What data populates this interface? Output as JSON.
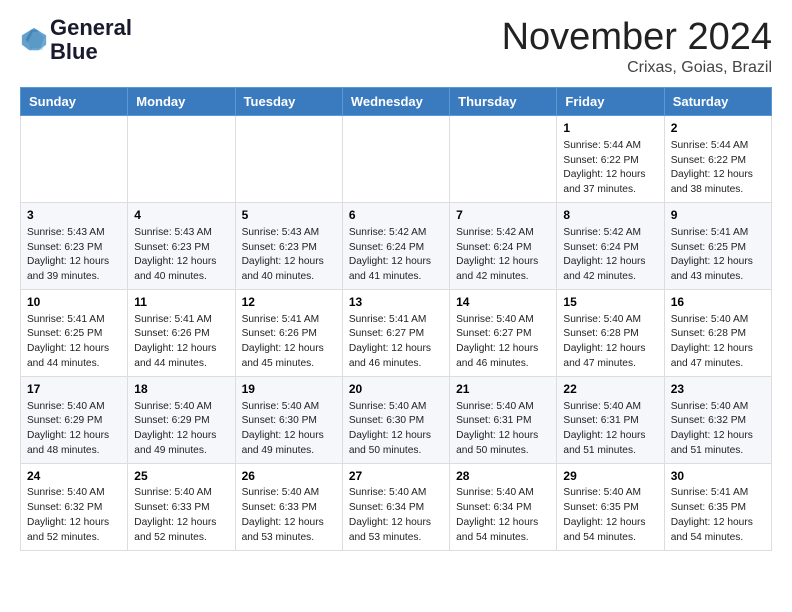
{
  "logo": {
    "line1": "General",
    "line2": "Blue"
  },
  "title": "November 2024",
  "location": "Crixas, Goias, Brazil",
  "headers": [
    "Sunday",
    "Monday",
    "Tuesday",
    "Wednesday",
    "Thursday",
    "Friday",
    "Saturday"
  ],
  "weeks": [
    [
      {
        "day": "",
        "info": ""
      },
      {
        "day": "",
        "info": ""
      },
      {
        "day": "",
        "info": ""
      },
      {
        "day": "",
        "info": ""
      },
      {
        "day": "",
        "info": ""
      },
      {
        "day": "1",
        "info": "Sunrise: 5:44 AM\nSunset: 6:22 PM\nDaylight: 12 hours\nand 37 minutes."
      },
      {
        "day": "2",
        "info": "Sunrise: 5:44 AM\nSunset: 6:22 PM\nDaylight: 12 hours\nand 38 minutes."
      }
    ],
    [
      {
        "day": "3",
        "info": "Sunrise: 5:43 AM\nSunset: 6:23 PM\nDaylight: 12 hours\nand 39 minutes."
      },
      {
        "day": "4",
        "info": "Sunrise: 5:43 AM\nSunset: 6:23 PM\nDaylight: 12 hours\nand 40 minutes."
      },
      {
        "day": "5",
        "info": "Sunrise: 5:43 AM\nSunset: 6:23 PM\nDaylight: 12 hours\nand 40 minutes."
      },
      {
        "day": "6",
        "info": "Sunrise: 5:42 AM\nSunset: 6:24 PM\nDaylight: 12 hours\nand 41 minutes."
      },
      {
        "day": "7",
        "info": "Sunrise: 5:42 AM\nSunset: 6:24 PM\nDaylight: 12 hours\nand 42 minutes."
      },
      {
        "day": "8",
        "info": "Sunrise: 5:42 AM\nSunset: 6:24 PM\nDaylight: 12 hours\nand 42 minutes."
      },
      {
        "day": "9",
        "info": "Sunrise: 5:41 AM\nSunset: 6:25 PM\nDaylight: 12 hours\nand 43 minutes."
      }
    ],
    [
      {
        "day": "10",
        "info": "Sunrise: 5:41 AM\nSunset: 6:25 PM\nDaylight: 12 hours\nand 44 minutes."
      },
      {
        "day": "11",
        "info": "Sunrise: 5:41 AM\nSunset: 6:26 PM\nDaylight: 12 hours\nand 44 minutes."
      },
      {
        "day": "12",
        "info": "Sunrise: 5:41 AM\nSunset: 6:26 PM\nDaylight: 12 hours\nand 45 minutes."
      },
      {
        "day": "13",
        "info": "Sunrise: 5:41 AM\nSunset: 6:27 PM\nDaylight: 12 hours\nand 46 minutes."
      },
      {
        "day": "14",
        "info": "Sunrise: 5:40 AM\nSunset: 6:27 PM\nDaylight: 12 hours\nand 46 minutes."
      },
      {
        "day": "15",
        "info": "Sunrise: 5:40 AM\nSunset: 6:28 PM\nDaylight: 12 hours\nand 47 minutes."
      },
      {
        "day": "16",
        "info": "Sunrise: 5:40 AM\nSunset: 6:28 PM\nDaylight: 12 hours\nand 47 minutes."
      }
    ],
    [
      {
        "day": "17",
        "info": "Sunrise: 5:40 AM\nSunset: 6:29 PM\nDaylight: 12 hours\nand 48 minutes."
      },
      {
        "day": "18",
        "info": "Sunrise: 5:40 AM\nSunset: 6:29 PM\nDaylight: 12 hours\nand 49 minutes."
      },
      {
        "day": "19",
        "info": "Sunrise: 5:40 AM\nSunset: 6:30 PM\nDaylight: 12 hours\nand 49 minutes."
      },
      {
        "day": "20",
        "info": "Sunrise: 5:40 AM\nSunset: 6:30 PM\nDaylight: 12 hours\nand 50 minutes."
      },
      {
        "day": "21",
        "info": "Sunrise: 5:40 AM\nSunset: 6:31 PM\nDaylight: 12 hours\nand 50 minutes."
      },
      {
        "day": "22",
        "info": "Sunrise: 5:40 AM\nSunset: 6:31 PM\nDaylight: 12 hours\nand 51 minutes."
      },
      {
        "day": "23",
        "info": "Sunrise: 5:40 AM\nSunset: 6:32 PM\nDaylight: 12 hours\nand 51 minutes."
      }
    ],
    [
      {
        "day": "24",
        "info": "Sunrise: 5:40 AM\nSunset: 6:32 PM\nDaylight: 12 hours\nand 52 minutes."
      },
      {
        "day": "25",
        "info": "Sunrise: 5:40 AM\nSunset: 6:33 PM\nDaylight: 12 hours\nand 52 minutes."
      },
      {
        "day": "26",
        "info": "Sunrise: 5:40 AM\nSunset: 6:33 PM\nDaylight: 12 hours\nand 53 minutes."
      },
      {
        "day": "27",
        "info": "Sunrise: 5:40 AM\nSunset: 6:34 PM\nDaylight: 12 hours\nand 53 minutes."
      },
      {
        "day": "28",
        "info": "Sunrise: 5:40 AM\nSunset: 6:34 PM\nDaylight: 12 hours\nand 54 minutes."
      },
      {
        "day": "29",
        "info": "Sunrise: 5:40 AM\nSunset: 6:35 PM\nDaylight: 12 hours\nand 54 minutes."
      },
      {
        "day": "30",
        "info": "Sunrise: 5:41 AM\nSunset: 6:35 PM\nDaylight: 12 hours\nand 54 minutes."
      }
    ]
  ]
}
